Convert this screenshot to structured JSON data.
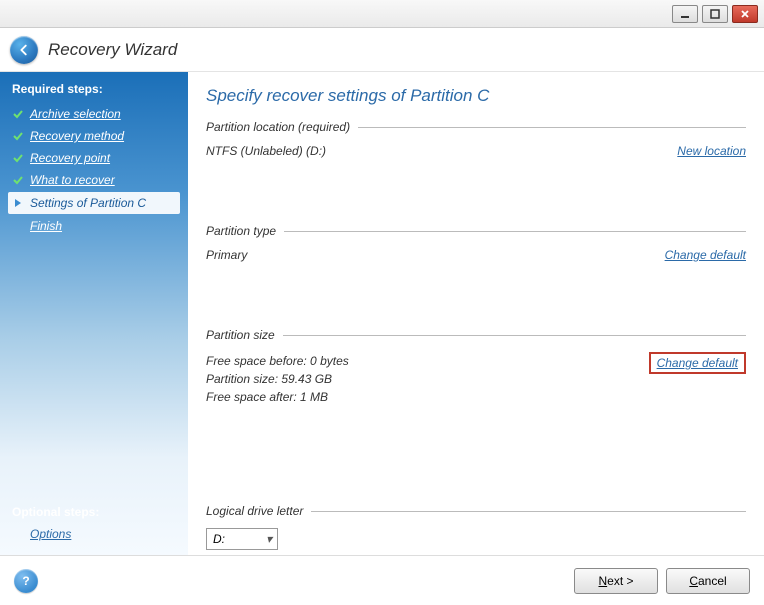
{
  "window": {
    "title": "Recovery Wizard"
  },
  "sidebar": {
    "required_heading": "Required steps:",
    "optional_heading": "Optional steps:",
    "steps": [
      {
        "label": "Archive selection",
        "state": "done"
      },
      {
        "label": "Recovery method",
        "state": "done"
      },
      {
        "label": "Recovery point",
        "state": "done"
      },
      {
        "label": "What to recover",
        "state": "done"
      },
      {
        "label": "Settings of Partition C",
        "state": "current"
      },
      {
        "label": "Finish",
        "state": "future"
      }
    ],
    "options_label": "Options"
  },
  "main": {
    "title": "Specify recover settings of Partition C",
    "location": {
      "heading": "Partition location (required)",
      "value": "NTFS (Unlabeled) (D:)",
      "link": "New location"
    },
    "type": {
      "heading": "Partition type",
      "value": "Primary",
      "link": "Change default"
    },
    "size": {
      "heading": "Partition size",
      "free_before": "Free space before: 0 bytes",
      "partition_size": "Partition size: 59.43 GB",
      "free_after": "Free space after: 1 MB",
      "link": "Change default"
    },
    "drive": {
      "heading": "Logical drive letter",
      "value": "D:"
    }
  },
  "footer": {
    "next": "ext >",
    "next_key": "N",
    "cancel": "ancel",
    "cancel_key": "C"
  }
}
